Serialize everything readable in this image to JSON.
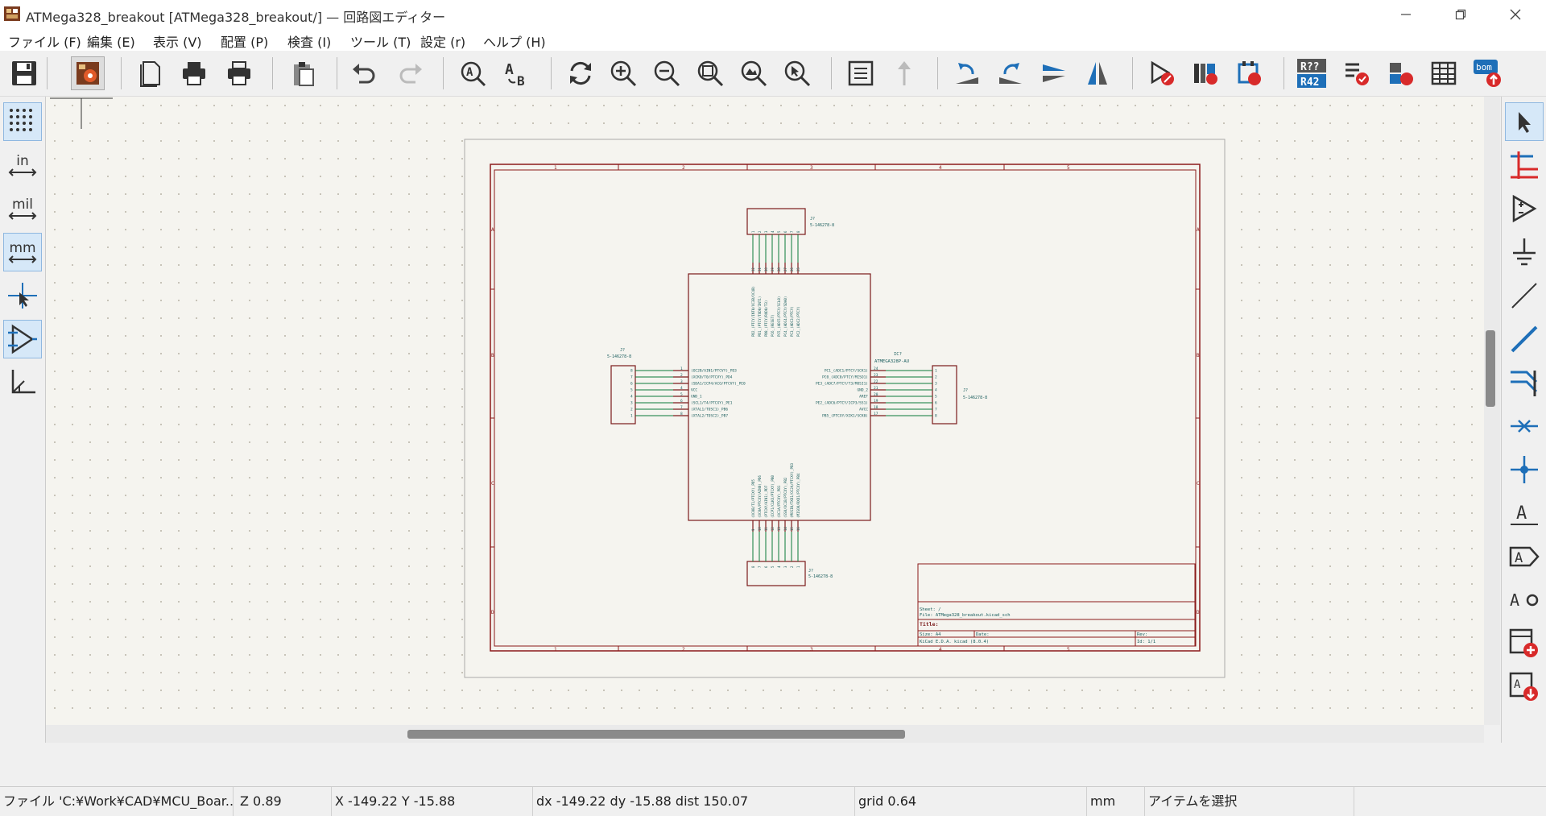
{
  "window": {
    "title": "ATMega328_breakout [ATMega328_breakout/] — 回路図エディター",
    "controls": [
      "minimize",
      "maximize",
      "close"
    ]
  },
  "menu": {
    "items": [
      "ファイル (F)",
      "編集 (E)",
      "表示 (V)",
      "配置 (P)",
      "検査 (I)",
      "ツール (T)",
      "設定 (r)",
      "ヘルプ (H)"
    ]
  },
  "toolbar": {
    "icons": [
      "save-icon",
      "schematic-setup-icon",
      "page-settings-icon",
      "print-icon",
      "plot-icon",
      "paste-icon",
      "undo-icon",
      "redo-icon",
      "find-icon",
      "find-replace-icon",
      "refresh-icon",
      "zoom-in-icon",
      "zoom-out-icon",
      "zoom-fit-icon",
      "zoom-objects-icon",
      "zoom-selection-icon",
      "hierarchy-navigator-icon",
      "leave-sheet-icon",
      "rotate-ccw-icon",
      "rotate-cw-icon",
      "mirror-vertical-icon",
      "mirror-horizontal-icon",
      "symbol-editor-icon",
      "symbol-browser-icon",
      "footprint-editor-icon",
      "annotate-icon",
      "erc-icon",
      "assign-footprints-icon",
      "bom-table-icon",
      "bom-export-icon"
    ],
    "annotate_label_top": "R??",
    "annotate_label_bottom": "R42",
    "bom_label": "bom"
  },
  "left_toolbar": {
    "grid": "grid-icon",
    "units_in": "in",
    "units_mil": "mil",
    "units_mm": "mm",
    "cursor": "full-cursor-icon",
    "hidden_pins": "hidden-pins-icon",
    "wire_angle": "wire-angle-icon"
  },
  "right_toolbar": {
    "icons": [
      "select-icon",
      "highlight-net-icon",
      "add-symbol-icon",
      "add-power-icon",
      "add-wire-icon",
      "add-bus-icon",
      "add-bus-entry-icon",
      "no-connect-icon",
      "add-junction-icon",
      "add-label-icon",
      "add-global-label-icon",
      "add-text-icon",
      "add-sheet-icon",
      "import-sheet-pin-icon"
    ]
  },
  "schematic": {
    "sheet_cols": [
      "1",
      "2",
      "3",
      "4",
      "5"
    ],
    "sheet_rows": [
      "A",
      "B",
      "C",
      "D"
    ],
    "j_top": {
      "ref": "J?",
      "value": "5-146278-8",
      "pins": [
        "1",
        "2",
        "3",
        "4",
        "5",
        "6",
        "7",
        "8"
      ]
    },
    "j_left": {
      "ref": "J?",
      "value": "5-146278-8",
      "pins": [
        "8",
        "7",
        "6",
        "5",
        "4",
        "3",
        "2",
        "1"
      ]
    },
    "j_right": {
      "ref": "J?",
      "value": "5-146278-8",
      "pins": [
        "1",
        "2",
        "3",
        "4",
        "5",
        "6",
        "7",
        "8"
      ]
    },
    "j_bottom": {
      "ref": "J?",
      "value": "5-146278-8",
      "pins": [
        "8",
        "7",
        "6",
        "5",
        "4",
        "3",
        "2",
        "1"
      ]
    },
    "ic": {
      "ref": "IC?",
      "value": "ATMEGA328P-AU",
      "left_pins": [
        "(OC2B/AIN1/PTCVY)_PD3",
        "(XCK0/T0/PTCVY)_PD4",
        "(SDA1/ICP4/ACO/PTCVY)_PE0",
        "VCC",
        "GND_1",
        "(SCL1/T4/PTCXY)_PE1",
        "(XTAL1/TOSC1)_PB6",
        "(XTAL2/TOSC2)_PB7"
      ],
      "left_nums": [
        "1",
        "2",
        "3",
        "4",
        "5",
        "6",
        "7",
        "8"
      ],
      "right_pins": [
        "PC1_(ADC1/PTCY/SCK1)",
        "PC0_(ADC0/PTCY/MISO1)",
        "PE3_(ADC7/PTCY/T3/MOSI1)",
        "GND_2",
        "AREF",
        "PE2_(ADC6/PTCY/ICP3/SS1)",
        "AVCC",
        "PB5_(PTCXY/XCK1/SCK0)"
      ],
      "right_nums": [
        "24",
        "23",
        "22",
        "21",
        "20",
        "19",
        "18",
        "17"
      ],
      "top_pins": [
        "PD2_(PTCY/INT0/OC3B/OC4B)",
        "PD1_(PTCY/TXD0/INT1)",
        "PD0_(PTCY/RXD0/T3)",
        "PC6_(RESET)",
        "PC5_(ADC5/PTCY/SCL0)",
        "PC4_(ADC4/PTCY/SDA0)",
        "PC3_(ADC3/PTCY)",
        "PC2_(ADC2/PTCY)"
      ],
      "top_nums": [
        "32",
        "31",
        "30",
        "29",
        "28",
        "27",
        "26",
        "25"
      ],
      "bottom_pins": [
        "(OC0B/T1/PTCXY)_PD5",
        "(OC0A/PTCXY/AIN0)_PD6",
        "(PTCXY/AIN1)_PD7",
        "(ICP1/CLKO/PTCXY)_PB0",
        "(OC1A/PTCXY)_PB1",
        "(SS0/OC1B/PTCXY)_PB2",
        "(MOSI0/TXD1/OC2A/PTCXY)_PB3",
        "(MISO0/RXD1/PTCXY)_PB4"
      ],
      "bottom_nums": [
        "9",
        "10",
        "11",
        "12",
        "13",
        "14",
        "15",
        "16"
      ]
    },
    "title_block": {
      "sheet": "Sheet: /",
      "file": "File: ATMega328_breakout.kicad_sch",
      "title": "Title:",
      "size": "Size: A4",
      "date": "Date:",
      "rev": "Rev:",
      "tool": "KiCad E.D.A.  kicad (8.0.4)",
      "id": "Id: 1/1"
    }
  },
  "status": {
    "file": "ファイル 'C:¥Work¥CAD¥MCU_Boar...",
    "zoom": "Z 0.89",
    "xy": "X -149.22  Y -15.88",
    "delta": "dx -149.22  dy -15.88  dist 150.07",
    "grid": "grid 0.64",
    "units": "mm",
    "mode": "アイテムを選択"
  },
  "colors": {
    "sheet_border": "#8b1a1a",
    "component": "#7a1a1a",
    "pin_text": "#1b5e5e",
    "wire": "#0a7a3a",
    "canvas_bg": "#f5f4ef",
    "icon_blue": "#1e6fb8"
  }
}
